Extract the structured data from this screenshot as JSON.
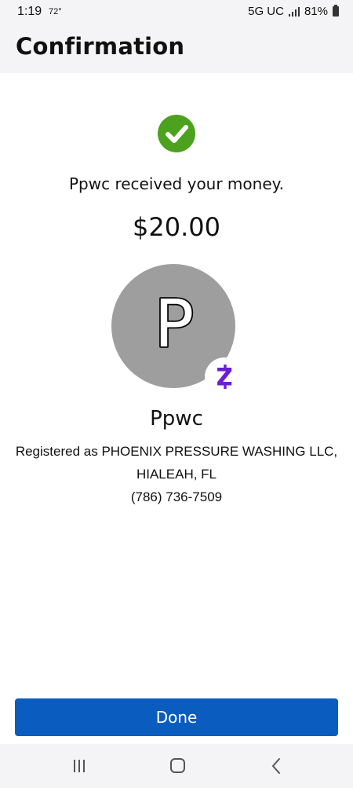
{
  "status_bar": {
    "time": "1:19",
    "temperature": "72°",
    "network": "5G UC",
    "battery": "81%"
  },
  "header": {
    "title": "Confirmation"
  },
  "confirmation": {
    "icon": "check-circle-icon",
    "message": "Ppwc received your money.",
    "amount": "$20.00"
  },
  "recipient": {
    "avatar_letter": "P",
    "badge_icon": "zelle-logo-icon",
    "name": "Ppwc",
    "registered_line": "Registered as PHOENIX PRESSURE WASHING LLC,",
    "location": "HIALEAH, FL",
    "phone": "(786) 736-7509"
  },
  "actions": {
    "done_label": "Done"
  },
  "nav": {
    "recents_icon": "recents-icon",
    "home_icon": "home-icon",
    "back_icon": "back-icon"
  },
  "colors": {
    "success_green": "#4ca21f",
    "button_blue": "#0a5cbf",
    "zelle_purple": "#6d1ed4",
    "avatar_gray": "#9e9e9e"
  }
}
